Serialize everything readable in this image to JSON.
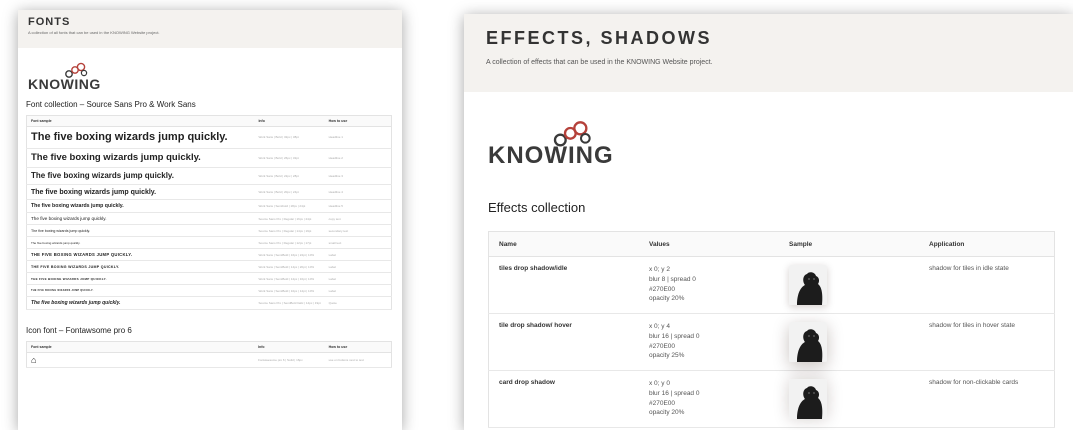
{
  "left": {
    "title": "FONTS",
    "subtitle": "A collection of all fonts that can be used in the KNOWING Website project.",
    "logo_text": "KNOWING",
    "section_title": "Font collection – Source Sans Pro & Work Sans",
    "columns": [
      "Font sample",
      "Info",
      "How to use"
    ],
    "rows": [
      {
        "sample": "The five boxing wizards jump quickly.",
        "info": "Work Sans | Bold | 32px | 38pt",
        "use": "Headline 1",
        "size": 11,
        "weight": 800,
        "style": "normal",
        "upper": false
      },
      {
        "sample": "The five boxing wizards jump quickly.",
        "info": "Work Sans | Bold | 26px | 32pt",
        "use": "Headline 2",
        "size": 9.5,
        "weight": 800,
        "style": "normal",
        "upper": false
      },
      {
        "sample": "The five boxing wizards jump quickly.",
        "info": "Work Sans | Bold | 22px | 28pt",
        "use": "Headline 3",
        "size": 8,
        "weight": 800,
        "style": "normal",
        "upper": false
      },
      {
        "sample": "The five boxing wizards jump quickly.",
        "info": "Work Sans | Bold | 20px | 24pt",
        "use": "Headline 4",
        "size": 7,
        "weight": 800,
        "style": "normal",
        "upper": false
      },
      {
        "sample": "The five boxing wizards jump quickly.",
        "info": "Work Sans | Semibold | 18px | 24pt",
        "use": "Headline 5",
        "size": 5.2,
        "weight": 700,
        "style": "normal",
        "upper": false
      },
      {
        "sample": "The five boxing wizards jump quickly.",
        "info": "Source Sans Pro | Regular | 16px | 24pt",
        "use": "copy text",
        "size": 4.6,
        "weight": 400,
        "style": "normal",
        "upper": false
      },
      {
        "sample": "The five boxing wizards jump quickly.",
        "info": "Source Sans Pro | Regular | 14px | 19pt",
        "use": "secondary text",
        "size": 3.6,
        "weight": 400,
        "style": "normal",
        "upper": false
      },
      {
        "sample": "The five boxing wizards jump quickly.",
        "info": "Source Sans Pro | Regular | 12px | 17pt",
        "use": "small text",
        "size": 3,
        "weight": 400,
        "style": "normal",
        "upper": false
      },
      {
        "sample": "The five boxing wizards jump quickly.",
        "info": "Work Sans | SemiBold | 16px | 24pt | 10%",
        "use": "Label",
        "size": 4.2,
        "weight": 700,
        "style": "normal",
        "upper": true
      },
      {
        "sample": "The five boxing wizards jump quickly.",
        "info": "Work Sans | SemiBold | 14px | 20pt | 10%",
        "use": "Label",
        "size": 3.6,
        "weight": 700,
        "style": "normal",
        "upper": true
      },
      {
        "sample": "The five boxing wizards jump quickly.",
        "info": "Work Sans | SemiBold | 12px | 16pt | 10%",
        "use": "Label",
        "size": 3,
        "weight": 700,
        "style": "normal",
        "upper": true
      },
      {
        "sample": "The five boxing wizards jump quickly.",
        "info": "Work Sans | SemiBold | 10px | 14pt | 10%",
        "use": "Label",
        "size": 2.4,
        "weight": 700,
        "style": "normal",
        "upper": true
      },
      {
        "sample": "The five boxing wizards jump quickly.",
        "info": "Source Sans Pro | SemiBold Italic | 14px | 19pt",
        "use": "Quote",
        "size": 5,
        "weight": 700,
        "style": "italic",
        "upper": false
      }
    ],
    "icon_section_title": "Icon font – Fontawsome pro 6",
    "icon_columns": [
      "Font sample",
      "Info",
      "How to use"
    ],
    "icon_rows": [
      {
        "sample": "⌂",
        "info": "Fontawesome pro 6 | Solid | 16px",
        "use": "use on buttons next to text"
      }
    ]
  },
  "right": {
    "title": "EFFECTS, SHADOWS",
    "subtitle": "A collection of effects that can be used in the KNOWING Website project.",
    "logo_text": "KNOWING",
    "section_title": "Effects collection",
    "columns": [
      "Name",
      "Values",
      "Sample",
      "Application"
    ],
    "rows": [
      {
        "name": "tiles drop shadow/idle",
        "values": [
          "x 0; y 2",
          "blur 8 | spread 0",
          "#270E00",
          "opacity 20%"
        ],
        "application": "shadow for tiles in idle state"
      },
      {
        "name": "tile drop shadow/ hover",
        "values": [
          "x 0; y 4",
          "blur 16 | spread 0",
          "#270E00",
          "opacity 25%"
        ],
        "application": "shadow for tiles in hover state"
      },
      {
        "name": "card drop shadow",
        "values": [
          "x 0; y 0",
          "blur 16 | spread 0",
          "#270E00",
          "opacity 20%"
        ],
        "application": "shadow for non-clickable cards"
      }
    ]
  },
  "colors": {
    "header_bg": "#f4f2ef",
    "logo_text": "#3a3a3a",
    "logo_gear": "#b5413a",
    "shadow_color": "#270E00"
  }
}
